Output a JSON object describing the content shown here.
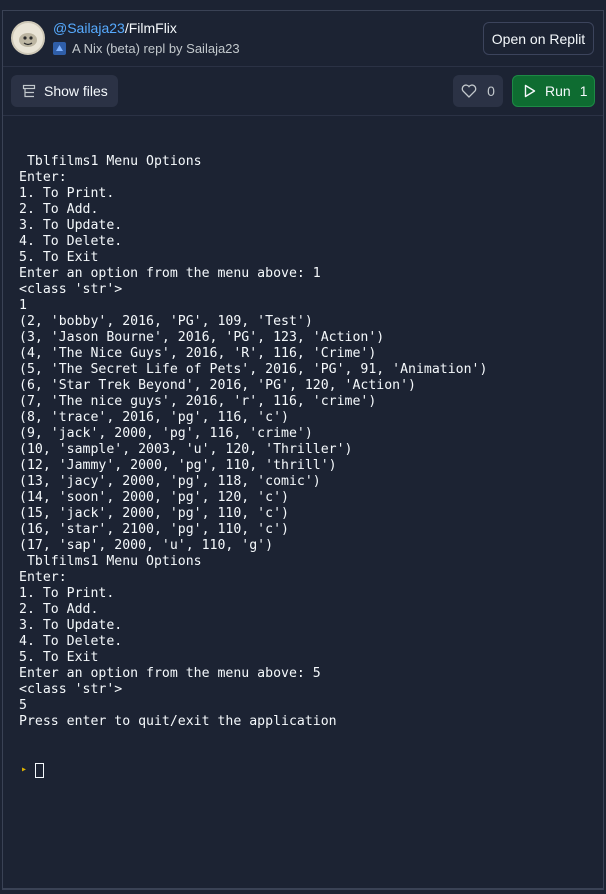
{
  "header": {
    "user": "@Sailaja23",
    "separator": "/",
    "repl_name": "FilmFlix",
    "subtitle": "A Nix (beta) repl by Sailaja23",
    "open_button": "Open on Replit"
  },
  "toolbar": {
    "show_files_label": "Show files",
    "likes": "0",
    "run_label": "Run",
    "run_count": "1"
  },
  "colors": {
    "background": "#1c2333",
    "surface": "#2b3245",
    "link": "#57abff",
    "run_green": "#0e6c31",
    "prompt_yellow": "#e0b400"
  },
  "console": {
    "lines": [
      " Tblfilms1 Menu Options",
      "Enter:",
      "1. To Print.",
      "2. To Add.",
      "3. To Update.",
      "4. To Delete.",
      "5. To Exit",
      "Enter an option from the menu above: 1",
      "<class 'str'>",
      "1",
      "(2, 'bobby', 2016, 'PG', 109, 'Test')",
      "(3, 'Jason Bourne', 2016, 'PG', 123, 'Action')",
      "(4, 'The Nice Guys', 2016, 'R', 116, 'Crime')",
      "(5, 'The Secret Life of Pets', 2016, 'PG', 91, 'Animation')",
      "(6, 'Star Trek Beyond', 2016, 'PG', 120, 'Action')",
      "(7, 'The nice guys', 2016, 'r', 116, 'crime')",
      "(8, 'trace', 2016, 'pg', 116, 'c')",
      "(9, 'jack', 2000, 'pg', 116, 'crime')",
      "(10, 'sample', 2003, 'u', 120, 'Thriller')",
      "(12, 'Jammy', 2000, 'pg', 110, 'thrill')",
      "(13, 'jacy', 2000, 'pg', 118, 'comic')",
      "(14, 'soon', 2000, 'pg', 120, 'c')",
      "(15, 'jack', 2000, 'pg', 110, 'c')",
      "(16, 'star', 2100, 'pg', 110, 'c')",
      "(17, 'sap', 2000, 'u', 110, 'g')",
      " Tblfilms1 Menu Options",
      "Enter:",
      "1. To Print.",
      "2. To Add.",
      "3. To Update.",
      "4. To Delete.",
      "5. To Exit",
      "Enter an option from the menu above: 5",
      "<class 'str'>",
      "5",
      "Press enter to quit/exit the application"
    ]
  }
}
